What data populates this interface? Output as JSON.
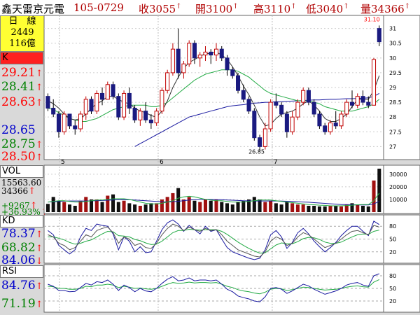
{
  "header": {
    "name": "鑫天雷京元電",
    "date": "105-0729",
    "close": "收3055",
    "open": "開3100",
    "high": "高3110",
    "low": "低3040",
    "volume": "量34366",
    "arrow": "↑"
  },
  "info": {
    "period": "日　線",
    "count": "2449",
    "amount": "116億"
  },
  "labels": {
    "k": "K",
    "vol": "VOL",
    "kd": "KD",
    "rsi": "RSI"
  },
  "price_left": [
    {
      "text": "29.21",
      "color": "#ff0000",
      "arrow": "↑"
    },
    {
      "text": "28.41",
      "color": "#008000",
      "arrow": "↑"
    },
    {
      "text": "28.63",
      "color": "#ff0000",
      "arrow": "↑"
    },
    {
      "text": "28.65",
      "color": "#0000cc",
      "arrow": ""
    },
    {
      "text": "28.75",
      "color": "#008000",
      "arrow": "↑"
    },
    {
      "text": "28.50",
      "color": "#ff0000",
      "arrow": "↑"
    }
  ],
  "vol_left": [
    {
      "text": "15563.60",
      "color": "#000000",
      "arrow": "↑"
    },
    {
      "text": "34366",
      "color": "#000000",
      "arrow": "↑"
    },
    {
      "text": "+9267",
      "color": "#008000",
      "arrow": "↑"
    },
    {
      "text": "+36.93%",
      "color": "#008000",
      "arrow": "↑"
    }
  ],
  "kd_left": [
    {
      "text": "78.37",
      "color": "#0000cc",
      "arrow": "↑"
    },
    {
      "text": "68.82",
      "color": "#008000",
      "arrow": "↑"
    },
    {
      "text": "84.06",
      "color": "#0000cc",
      "arrow": "↓"
    }
  ],
  "rsi_left": [
    {
      "text": "84.76",
      "color": "#0000cc",
      "arrow": "↑"
    },
    {
      "text": "71.19",
      "color": "#008000",
      "arrow": "↑"
    }
  ],
  "chart_data": {
    "type": "candlestick",
    "month_labels": [
      "5",
      "6",
      "7"
    ],
    "price_axis": {
      "ticks": [
        "31",
        "30.5",
        "30",
        "29.5",
        "29",
        "28.5",
        "28",
        "27.5",
        "27"
      ],
      "min": 26.7,
      "max": 31.3
    },
    "annotations": {
      "high": "31.10",
      "low": "26.85"
    },
    "candles": [
      [
        28.7,
        28.8,
        28.2,
        28.3
      ],
      [
        28.3,
        28.6,
        28.0,
        28.1
      ],
      [
        28.1,
        28.2,
        27.3,
        27.5
      ],
      [
        27.5,
        28.2,
        27.4,
        28.1
      ],
      [
        28.1,
        28.1,
        27.6,
        27.7
      ],
      [
        27.7,
        27.9,
        27.4,
        27.6
      ],
      [
        27.6,
        28.2,
        27.5,
        28.1
      ],
      [
        28.1,
        28.7,
        27.9,
        28.6
      ],
      [
        28.6,
        28.7,
        28.1,
        28.2
      ],
      [
        28.2,
        28.9,
        28.1,
        28.8
      ],
      [
        28.8,
        29.0,
        28.4,
        28.6
      ],
      [
        28.6,
        29.2,
        28.6,
        29.1
      ],
      [
        29.1,
        29.2,
        28.6,
        28.7
      ],
      [
        28.7,
        28.8,
        27.9,
        28.0
      ],
      [
        28.0,
        28.9,
        27.9,
        28.8
      ],
      [
        28.8,
        29.0,
        28.1,
        28.3
      ],
      [
        28.3,
        28.4,
        27.8,
        27.9
      ],
      [
        27.9,
        28.3,
        27.7,
        28.2
      ],
      [
        28.2,
        28.5,
        27.8,
        27.9
      ],
      [
        27.9,
        28.1,
        27.6,
        27.8
      ],
      [
        27.8,
        28.3,
        27.7,
        28.2
      ],
      [
        28.2,
        29.0,
        28.1,
        28.9
      ],
      [
        28.9,
        29.6,
        28.8,
        29.5
      ],
      [
        29.5,
        30.5,
        29.4,
        30.3
      ],
      [
        30.3,
        31.0,
        29.3,
        29.5
      ],
      [
        29.5,
        29.9,
        29.3,
        29.8
      ],
      [
        29.8,
        30.6,
        29.7,
        30.5
      ],
      [
        30.5,
        30.6,
        29.8,
        30.0
      ],
      [
        30.0,
        30.2,
        29.7,
        30.1
      ],
      [
        30.1,
        30.4,
        29.9,
        30.2
      ],
      [
        30.2,
        30.3,
        29.8,
        30.1
      ],
      [
        30.1,
        30.5,
        29.9,
        30.3
      ],
      [
        30.3,
        30.4,
        29.9,
        30.0
      ],
      [
        30.0,
        30.1,
        29.4,
        29.6
      ],
      [
        29.6,
        29.7,
        29.3,
        29.4
      ],
      [
        29.4,
        29.5,
        28.8,
        28.9
      ],
      [
        28.9,
        29.1,
        28.5,
        28.6
      ],
      [
        28.6,
        28.7,
        28.1,
        28.2
      ],
      [
        28.2,
        28.3,
        27.2,
        27.3
      ],
      [
        27.3,
        27.4,
        26.85,
        27.0
      ],
      [
        27.0,
        27.8,
        26.9,
        27.6
      ],
      [
        27.6,
        28.6,
        27.5,
        28.5
      ],
      [
        28.5,
        28.8,
        28.3,
        28.4
      ],
      [
        28.4,
        28.5,
        28.0,
        28.1
      ],
      [
        28.1,
        28.2,
        27.3,
        27.5
      ],
      [
        27.5,
        28.2,
        27.4,
        28.0
      ],
      [
        28.0,
        28.6,
        27.9,
        28.5
      ],
      [
        28.5,
        29.0,
        28.4,
        28.9
      ],
      [
        28.9,
        29.0,
        28.4,
        28.5
      ],
      [
        28.5,
        28.6,
        28.0,
        28.1
      ],
      [
        28.1,
        28.2,
        27.6,
        27.7
      ],
      [
        27.7,
        27.8,
        27.4,
        27.5
      ],
      [
        27.5,
        27.9,
        27.4,
        27.8
      ],
      [
        27.8,
        28.2,
        27.6,
        27.7
      ],
      [
        27.7,
        28.2,
        27.6,
        28.1
      ],
      [
        28.1,
        28.6,
        28.0,
        28.5
      ],
      [
        28.5,
        28.9,
        28.3,
        28.4
      ],
      [
        28.4,
        28.8,
        28.3,
        28.7
      ],
      [
        28.7,
        28.9,
        28.4,
        28.5
      ],
      [
        28.5,
        28.7,
        28.3,
        28.4
      ],
      [
        28.4,
        30.0,
        28.4,
        29.95
      ],
      [
        31.0,
        31.1,
        30.4,
        30.55
      ]
    ],
    "ma_short": [
      28.55,
      28.45,
      28.3,
      28.1,
      27.95,
      27.9,
      27.95,
      28.1,
      28.3,
      28.45,
      28.55,
      28.7,
      28.7,
      28.6,
      28.5,
      28.45,
      28.3,
      28.2,
      28.15,
      28.05,
      28.0,
      28.2,
      28.55,
      29.0,
      29.35,
      29.65,
      29.85,
      29.95,
      30.05,
      30.15,
      30.15,
      30.2,
      30.1,
      29.95,
      29.7,
      29.4,
      29.05,
      28.75,
      28.4,
      28.0,
      27.7,
      27.75,
      27.95,
      28.1,
      28.15,
      28.2,
      28.3,
      28.45,
      28.55,
      28.4,
      28.2,
      27.95,
      27.85,
      27.85,
      27.95,
      28.1,
      28.35,
      28.6,
      28.6,
      28.6,
      28.9,
      29.4
    ],
    "ma_mid": [
      28.3,
      28.25,
      28.15,
      28.05,
      27.95,
      27.9,
      27.85,
      27.85,
      27.9,
      27.95,
      28.05,
      28.15,
      28.25,
      28.3,
      28.35,
      28.4,
      28.4,
      28.4,
      28.4,
      28.35,
      28.35,
      28.4,
      28.5,
      28.65,
      28.8,
      28.95,
      29.1,
      29.25,
      29.35,
      29.45,
      29.5,
      29.55,
      29.6,
      29.6,
      29.6,
      29.55,
      29.45,
      29.35,
      29.2,
      29.05,
      28.9,
      28.8,
      28.75,
      28.7,
      28.65,
      28.6,
      28.55,
      28.55,
      28.55,
      28.5,
      28.45,
      28.35,
      28.3,
      28.25,
      28.2,
      28.2,
      28.2,
      28.25,
      28.3,
      28.35,
      28.45,
      28.6
    ],
    "ma_long": [
      null,
      null,
      null,
      null,
      null,
      null,
      null,
      null,
      null,
      null,
      null,
      null,
      null,
      null,
      null,
      null,
      27.0,
      27.1,
      27.2,
      27.3,
      27.4,
      27.5,
      27.6,
      27.7,
      27.8,
      27.9,
      28.0,
      28.05,
      28.1,
      28.15,
      28.2,
      28.25,
      28.3,
      28.35,
      28.38,
      28.4,
      28.42,
      28.45,
      28.47,
      28.48,
      28.5,
      28.5,
      28.52,
      28.52,
      28.53,
      28.54,
      28.55,
      28.56,
      28.57,
      28.58,
      28.58,
      28.59,
      28.6,
      28.6,
      28.61,
      28.62,
      28.62,
      28.63,
      28.64,
      28.65,
      28.7,
      28.8
    ],
    "volume": {
      "ticks": [
        "30000",
        "20000",
        "10000"
      ],
      "max": 36000,
      "values": [
        6500,
        12000,
        9000,
        8000,
        6000,
        5000,
        9000,
        12000,
        10000,
        10000,
        8000,
        13000,
        14000,
        8000,
        9000,
        7000,
        6000,
        5000,
        6000,
        7000,
        7000,
        10000,
        12000,
        15000,
        19000,
        10000,
        12000,
        9000,
        8000,
        10000,
        9000,
        10000,
        8000,
        7000,
        6000,
        8000,
        9000,
        10000,
        12000,
        10000,
        8000,
        9000,
        7000,
        6000,
        8000,
        7000,
        6000,
        6000,
        5000,
        5000,
        4500,
        4500,
        5000,
        5000,
        4500,
        6000,
        7000,
        6000,
        5000,
        4500,
        25000,
        34366
      ],
      "ma5": [
        8000,
        8500,
        9000,
        9000,
        8500,
        8000,
        8000,
        8500,
        9000,
        9500,
        9500,
        10000,
        10500,
        10500,
        10500,
        10000,
        9000,
        8000,
        7000,
        6500,
        6500,
        7000,
        8000,
        9000,
        11000,
        12000,
        12500,
        12000,
        11000,
        10000,
        9500,
        9000,
        9000,
        8500,
        8000,
        8000,
        8000,
        8500,
        9000,
        9500,
        9500,
        9500,
        9000,
        8500,
        8000,
        7500,
        7000,
        6500,
        6000,
        5800,
        5500,
        5300,
        5000,
        5000,
        5000,
        5200,
        5500,
        5800,
        5900,
        5900,
        9000,
        15000
      ],
      "ma10": [
        8000,
        8200,
        8500,
        8700,
        8800,
        8800,
        8800,
        8800,
        8900,
        9000,
        9200,
        9400,
        9600,
        9800,
        9900,
        9800,
        9600,
        9300,
        9000,
        8700,
        8400,
        8200,
        8100,
        8200,
        8600,
        9000,
        9500,
        9800,
        10000,
        10000,
        10000,
        9900,
        9800,
        9600,
        9400,
        9200,
        9000,
        8900,
        8800,
        8800,
        8800,
        8800,
        8800,
        8700,
        8600,
        8400,
        8200,
        8000,
        7800,
        7500,
        7200,
        6900,
        6600,
        6300,
        6000,
        5900,
        5800,
        5700,
        5700,
        5700,
        6500,
        8500
      ]
    },
    "kd": {
      "ticks": [
        "80",
        "50",
        "20"
      ],
      "k": [
        60,
        55,
        40,
        35,
        25,
        30,
        45,
        60,
        55,
        70,
        75,
        78,
        65,
        40,
        55,
        50,
        35,
        40,
        30,
        28,
        40,
        60,
        75,
        85,
        80,
        70,
        78,
        72,
        68,
        75,
        70,
        72,
        60,
        45,
        35,
        25,
        20,
        15,
        10,
        8,
        20,
        45,
        55,
        50,
        35,
        40,
        55,
        65,
        60,
        50,
        40,
        30,
        35,
        40,
        50,
        60,
        68,
        70,
        65,
        60,
        82,
        78
      ],
      "d": [
        55,
        55,
        52,
        48,
        42,
        38,
        40,
        45,
        48,
        55,
        62,
        68,
        67,
        58,
        57,
        55,
        49,
        46,
        41,
        37,
        38,
        45,
        55,
        65,
        70,
        70,
        73,
        72,
        71,
        72,
        72,
        72,
        68,
        61,
        52,
        43,
        35,
        28,
        22,
        17,
        18,
        27,
        36,
        41,
        39,
        39,
        44,
        51,
        54,
        53,
        49,
        43,
        40,
        40,
        43,
        49,
        55,
        60,
        62,
        61,
        68,
        71
      ],
      "j": [
        70,
        60,
        35,
        25,
        15,
        25,
        55,
        75,
        70,
        85,
        82,
        80,
        62,
        25,
        55,
        45,
        20,
        32,
        18,
        20,
        45,
        72,
        88,
        95,
        85,
        68,
        82,
        72,
        62,
        80,
        68,
        72,
        50,
        30,
        20,
        15,
        10,
        5,
        2,
        5,
        25,
        60,
        70,
        55,
        28,
        42,
        65,
        75,
        62,
        45,
        32,
        20,
        30,
        42,
        58,
        70,
        80,
        80,
        68,
        58,
        92,
        84
      ]
    },
    "rsi": {
      "ticks": [
        "80",
        "50",
        "20"
      ],
      "rsi_short": [
        60,
        55,
        45,
        45,
        42,
        43,
        52,
        62,
        58,
        66,
        64,
        70,
        60,
        45,
        58,
        52,
        42,
        50,
        44,
        42,
        50,
        62,
        72,
        78,
        68,
        70,
        75,
        68,
        70,
        70,
        68,
        70,
        60,
        48,
        42,
        32,
        28,
        25,
        20,
        18,
        30,
        50,
        52,
        48,
        38,
        44,
        52,
        60,
        56,
        48,
        42,
        36,
        40,
        44,
        50,
        58,
        62,
        64,
        58,
        55,
        80,
        85
      ],
      "rsi_long": [
        55,
        54,
        50,
        50,
        48,
        48,
        50,
        55,
        54,
        58,
        58,
        60,
        58,
        52,
        55,
        53,
        50,
        51,
        49,
        48,
        50,
        55,
        60,
        64,
        62,
        63,
        65,
        63,
        64,
        64,
        63,
        64,
        60,
        55,
        52,
        47,
        44,
        42,
        39,
        37,
        41,
        48,
        50,
        49,
        45,
        47,
        50,
        53,
        52,
        50,
        48,
        46,
        47,
        48,
        50,
        53,
        55,
        56,
        54,
        53,
        65,
        71
      ]
    }
  }
}
